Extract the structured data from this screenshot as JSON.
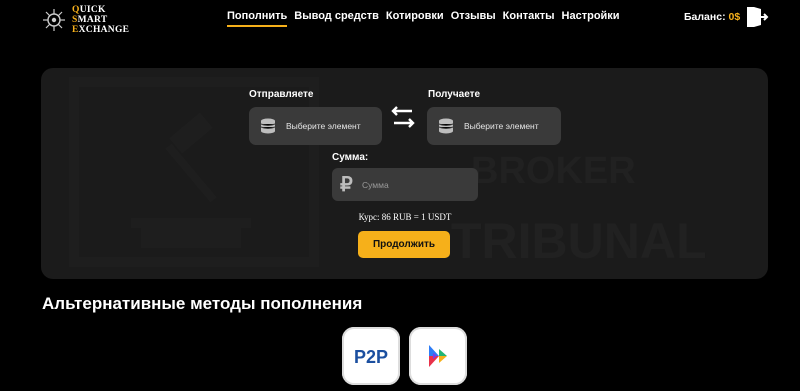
{
  "logo": {
    "lines": [
      {
        "acc": "Q",
        "rest": "UICK"
      },
      {
        "acc": "S",
        "rest": "MART"
      },
      {
        "acc": "E",
        "rest": "XCHANGE"
      }
    ]
  },
  "nav": {
    "items": [
      "Пополнить",
      "Вывод средств",
      "Котировки",
      "Отзывы",
      "Контакты",
      "Настройки"
    ]
  },
  "balance": {
    "label": "Баланс: ",
    "value": "0$"
  },
  "exchange": {
    "send_label": "Отправляете",
    "receive_label": "Получаете",
    "send_select": "Выберите элемент",
    "receive_select": "Выберите элемент",
    "sum_label": "Сумма:",
    "sum_symbol": "₽",
    "sum_placeholder": "Сумма",
    "rate": "Курс: 86 RUB = 1 USDT",
    "continue_label": "Продолжить"
  },
  "watermark": {
    "line1": "BROKER",
    "line2": "TRIBUNAL"
  },
  "alt": {
    "title": "Альтернативные методы пополнения",
    "methods": [
      {
        "icon": "p2p-icon",
        "text": "P2P"
      },
      {
        "icon": "play-logo-icon"
      }
    ]
  },
  "colors": {
    "accent": "#f6b01a",
    "card": "#1b1b1b",
    "field": "#3a3a3a"
  }
}
